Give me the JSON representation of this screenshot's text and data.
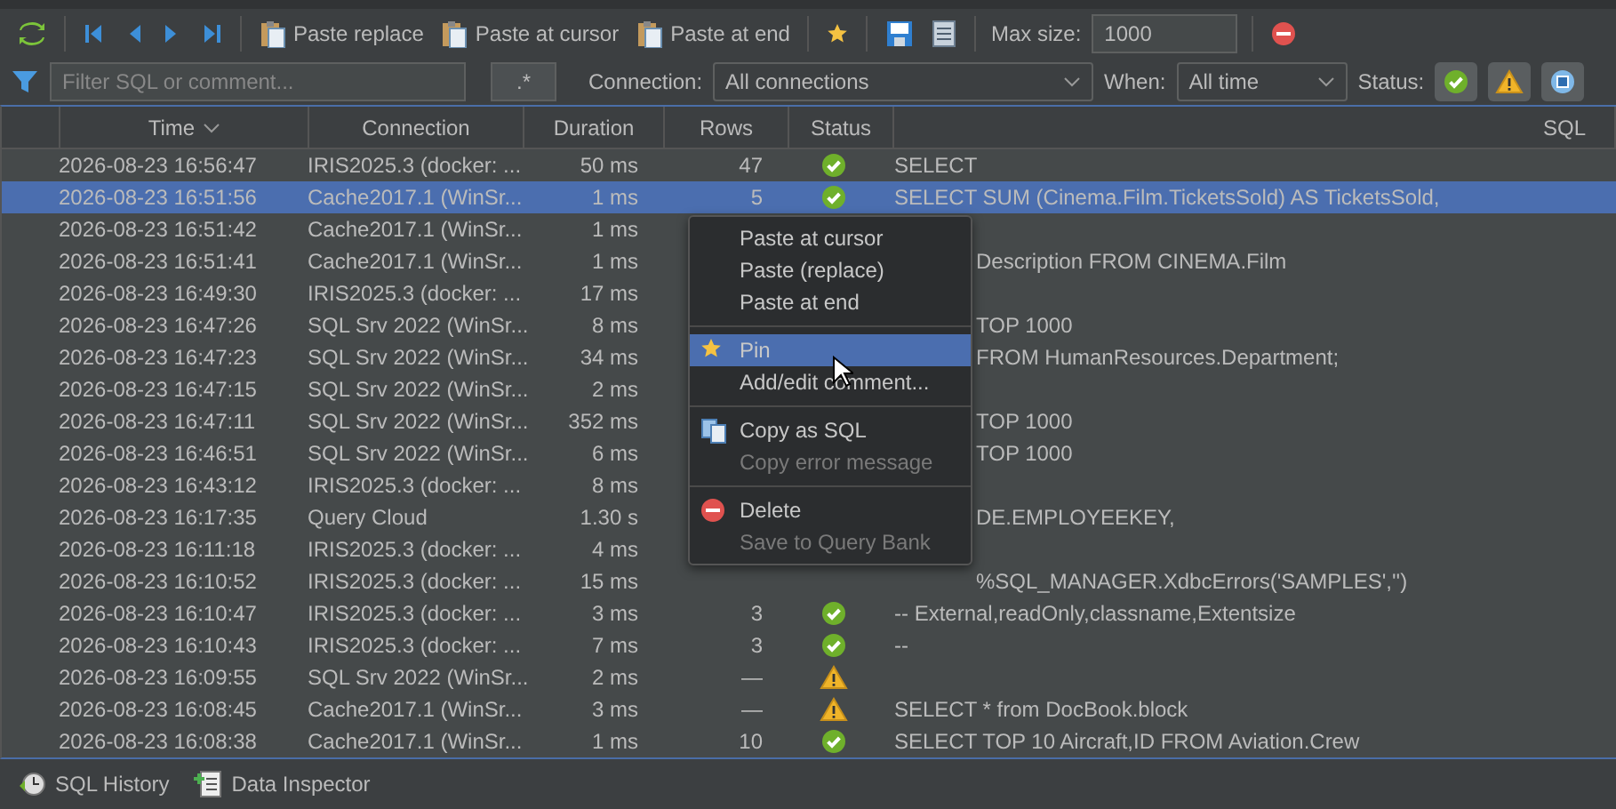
{
  "toolbar": {
    "paste_buttons": [
      "Paste replace",
      "Paste at cursor",
      "Paste at end"
    ],
    "max_size_label": "Max size:",
    "max_size": "1000"
  },
  "filter_bar": {
    "placeholder": "Filter SQL or comment...",
    "regex": ".*",
    "connection_label": "Connection:",
    "connection": "All connections",
    "when_label": "When:",
    "when": "All time",
    "status_label": "Status:",
    "status_toggles": [
      {
        "kind": "ok",
        "on": true
      },
      {
        "kind": "warning",
        "on": true
      },
      {
        "kind": "info",
        "on": true
      }
    ]
  },
  "table": {
    "columns": [
      "Time",
      "Connection",
      "Duration",
      "Rows",
      "Status",
      "SQL"
    ],
    "rows": [
      {
        "time": "2026-08-23 16:56:47",
        "connection": "IRIS2025.3 (docker: ...",
        "duration": "50 ms",
        "rows": "47",
        "warning": false,
        "sql": "SELECT",
        "selected": false
      },
      {
        "time": "2026-08-23 16:51:56",
        "connection": "Cache2017.1 (WinSr...",
        "duration": "1 ms",
        "rows": "5",
        "warning": false,
        "sql": "SELECT SUM (Cinema.Film.TicketsSold) AS TicketsSold,",
        "selected": true
      },
      {
        "time": "2026-08-23 16:51:42",
        "connection": "Cache2017.1 (WinSr...",
        "duration": "1 ms",
        "selected": false
      },
      {
        "time": "2026-08-23 16:51:41",
        "connection": "Cache2017.1 (WinSr...",
        "duration": "1 ms",
        "sql": "Description FROM CINEMA.Film",
        "selected": false
      },
      {
        "time": "2026-08-23 16:49:30",
        "connection": "IRIS2025.3 (docker: ...",
        "duration": "17 ms",
        "selected": false
      },
      {
        "time": "2026-08-23 16:47:26",
        "connection": "SQL Srv 2022 (WinSr...",
        "duration": "8 ms",
        "sql": "TOP 1000",
        "selected": false
      },
      {
        "time": "2026-08-23 16:47:23",
        "connection": "SQL Srv 2022 (WinSr...",
        "duration": "34 ms",
        "sql": "FROM HumanResources.Department;",
        "selected": false
      },
      {
        "time": "2026-08-23 16:47:15",
        "connection": "SQL Srv 2022 (WinSr...",
        "duration": "2 ms",
        "selected": false
      },
      {
        "time": "2026-08-23 16:47:11",
        "connection": "SQL Srv 2022 (WinSr...",
        "duration": "352 ms",
        "sql": "TOP 1000",
        "selected": false
      },
      {
        "time": "2026-08-23 16:46:51",
        "connection": "SQL Srv 2022 (WinSr...",
        "duration": "6 ms",
        "sql": "TOP 1000",
        "selected": false
      },
      {
        "time": "2026-08-23 16:43:12",
        "connection": "IRIS2025.3 (docker: ...",
        "duration": "8 ms",
        "selected": false
      },
      {
        "time": "2026-08-23 16:17:35",
        "connection": "Query Cloud",
        "duration": "1.30 s",
        "sql": "DE.EMPLOYEEKEY,",
        "selected": false
      },
      {
        "time": "2026-08-23 16:11:18",
        "connection": "IRIS2025.3 (docker: ...",
        "duration": "4 ms",
        "selected": false
      },
      {
        "time": "2026-08-23 16:10:52",
        "connection": "IRIS2025.3 (docker: ...",
        "duration": "15 ms",
        "sql": "%SQL_MANAGER.XdbcErrors('SAMPLES','')",
        "selected": false
      },
      {
        "time": "2026-08-23 16:10:47",
        "connection": "IRIS2025.3 (docker: ...",
        "duration": "3 ms",
        "rows": "3",
        "warning": false,
        "sql": "-- External,readOnly,classname,Extentsize",
        "selected": false
      },
      {
        "time": "2026-08-23 16:10:43",
        "connection": "IRIS2025.3 (docker: ...",
        "duration": "7 ms",
        "rows": "3",
        "warning": false,
        "sql": "--",
        "selected": false
      },
      {
        "time": "2026-08-23 16:09:55",
        "connection": "SQL Srv 2022 (WinSr...",
        "duration": "2 ms",
        "rows": "—",
        "warning": true,
        "selected": false
      },
      {
        "time": "2026-08-23 16:08:45",
        "connection": "Cache2017.1 (WinSr...",
        "duration": "3 ms",
        "rows": "—",
        "warning": true,
        "sql": "SELECT * from DocBook.block",
        "selected": false
      },
      {
        "time": "2026-08-23 16:08:38",
        "connection": "Cache2017.1 (WinSr...",
        "duration": "1 ms",
        "rows": "10",
        "warning": false,
        "sql": "SELECT TOP 10 Aircraft,ID FROM Aviation.Crew",
        "selected": false
      }
    ]
  },
  "context_menu": {
    "groups": [
      [
        {
          "label": "Paste at cursor",
          "selected": false,
          "disabled": false
        },
        {
          "label": "Paste (replace)",
          "selected": false,
          "disabled": false
        },
        {
          "label": "Paste at end",
          "selected": false,
          "disabled": false
        }
      ],
      [
        {
          "label": "Pin",
          "selected": true,
          "disabled": false
        },
        {
          "label": "Add/edit comment...",
          "selected": false,
          "disabled": false
        }
      ],
      [
        {
          "label": "Copy as SQL",
          "selected": false,
          "disabled": false
        },
        {
          "label": "Copy error message",
          "selected": false,
          "disabled": true
        }
      ],
      [
        {
          "label": "Delete",
          "selected": false,
          "disabled": false
        },
        {
          "label": "Save to Query Bank",
          "selected": false,
          "disabled": true
        }
      ]
    ]
  },
  "bottom_tabs": [
    {
      "label": "SQL History"
    },
    {
      "label": "Data Inspector"
    }
  ]
}
